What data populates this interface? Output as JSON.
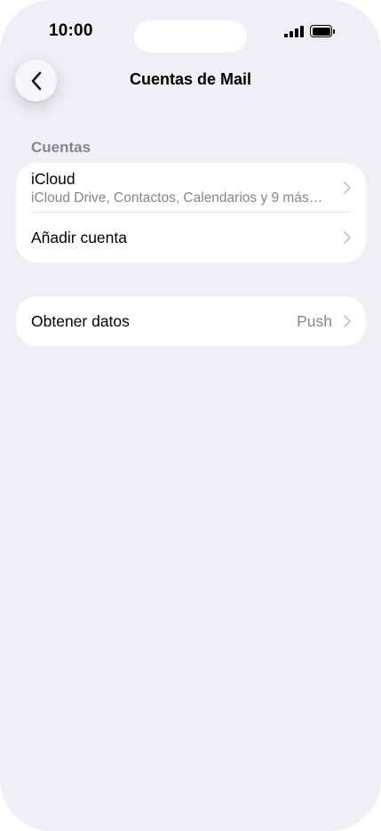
{
  "status_bar": {
    "time": "10:00"
  },
  "nav": {
    "title": "Cuentas de Mail",
    "back_icon": "chevron-left-icon"
  },
  "sections": {
    "accounts_header": "Cuentas",
    "accounts": [
      {
        "title": "iCloud",
        "subtitle": "iCloud Drive, Contactos, Calendarios y 9 más…"
      },
      {
        "title": "Añadir cuenta"
      }
    ],
    "fetch": {
      "title": "Obtener datos",
      "value": "Push"
    }
  },
  "colors": {
    "background": "#f0eff5",
    "secondary_text": "#86868c",
    "chevron": "#c4c4c8"
  }
}
